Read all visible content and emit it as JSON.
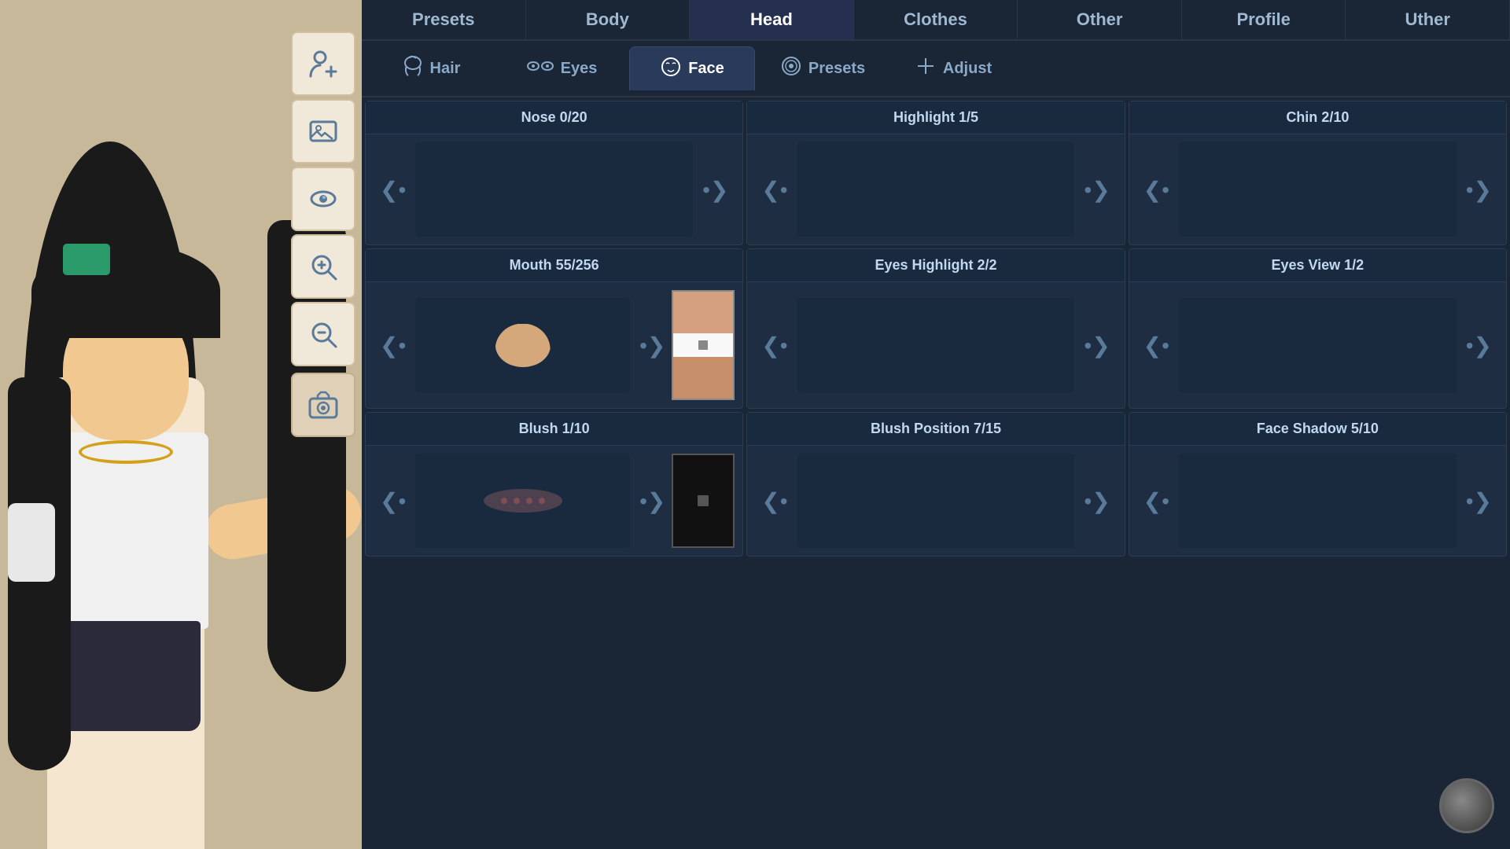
{
  "topnav": {
    "tabs": [
      {
        "id": "presets",
        "label": "Presets"
      },
      {
        "id": "body",
        "label": "Body"
      },
      {
        "id": "head",
        "label": "Head"
      },
      {
        "id": "clothes",
        "label": "Clothes"
      },
      {
        "id": "other",
        "label": "Other"
      },
      {
        "id": "profile",
        "label": "Profile"
      },
      {
        "id": "uther",
        "label": "Uther"
      }
    ],
    "active": "head"
  },
  "subtabs": [
    {
      "id": "hair",
      "label": "Hair",
      "icon": "🎭"
    },
    {
      "id": "eyes",
      "label": "Eyes",
      "icon": "👁"
    },
    {
      "id": "face",
      "label": "Face",
      "icon": "😐"
    },
    {
      "id": "presets",
      "label": "Presets",
      "icon": "🎭"
    },
    {
      "id": "adjust",
      "label": "Adjust",
      "icon": "✚"
    }
  ],
  "active_subtab": "face",
  "cells": [
    {
      "id": "nose",
      "header": "Nose 0/20",
      "has_color": false,
      "content_type": "empty"
    },
    {
      "id": "highlight",
      "header": "Highlight 1/5",
      "has_color": false,
      "content_type": "empty"
    },
    {
      "id": "chin",
      "header": "Chin 2/10",
      "has_color": false,
      "content_type": "empty"
    },
    {
      "id": "mouth",
      "header": "Mouth 55/256",
      "has_color": true,
      "content_type": "mouth"
    },
    {
      "id": "eyes_highlight",
      "header": "Eyes Highlight 2/2",
      "has_color": false,
      "content_type": "empty"
    },
    {
      "id": "eyes_view",
      "header": "Eyes View 1/2",
      "has_color": false,
      "content_type": "empty"
    },
    {
      "id": "blush",
      "header": "Blush 1/10",
      "has_color": true,
      "content_type": "blush"
    },
    {
      "id": "blush_position",
      "header": "Blush Position 7/15",
      "has_color": false,
      "content_type": "empty"
    },
    {
      "id": "face_shadow",
      "header": "Face Shadow 5/10",
      "has_color": false,
      "content_type": "empty"
    }
  ],
  "toolbar_buttons": [
    {
      "id": "add-user",
      "icon": "👤+",
      "unicode": "👤"
    },
    {
      "id": "image",
      "icon": "🖼",
      "unicode": "🖼"
    },
    {
      "id": "eye-view",
      "icon": "👁",
      "unicode": "👁"
    },
    {
      "id": "zoom-in",
      "icon": "🔍+",
      "unicode": "🔍"
    },
    {
      "id": "zoom-out",
      "icon": "🔍-",
      "unicode": "🔎"
    },
    {
      "id": "camera",
      "icon": "📷",
      "unicode": "📷"
    }
  ]
}
